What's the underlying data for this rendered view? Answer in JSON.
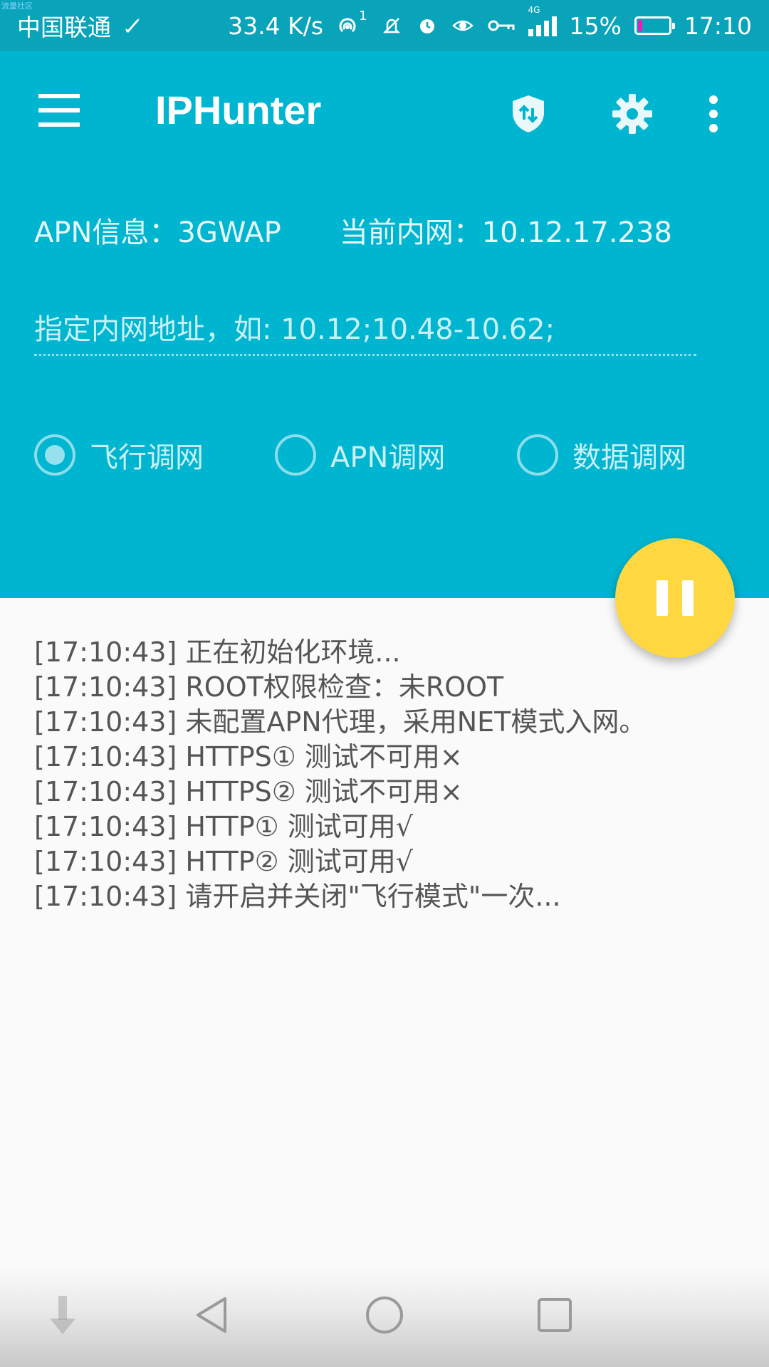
{
  "status_bar": {
    "corner_text": "流量社区",
    "carrier": "中国联通",
    "speed": "33.4 K/s",
    "hotspot_count": "1",
    "network_type": "4G",
    "battery": "15%",
    "battery_level": 0.15,
    "time": "17:10"
  },
  "toolbar": {
    "title": "IPHunter",
    "icons": [
      "menu-icon",
      "shield-icon",
      "gear-icon",
      "more-vert-icon"
    ]
  },
  "info": {
    "apn": "APN信息：3GWAP",
    "intranet": "当前内网：10.12.17.238"
  },
  "ip_input": {
    "value": "",
    "placeholder": "指定内网地址，如: 10.12;10.48-10.62;"
  },
  "mode_options": [
    {
      "label": "飞行调网",
      "selected": true
    },
    {
      "label": "APN调网",
      "selected": false
    },
    {
      "label": "数据调网",
      "selected": false
    }
  ],
  "fab": {
    "icon": "pause-icon"
  },
  "log": [
    "[17:10:43] 正在初始化环境...",
    "[17:10:43] ROOT权限检查：未ROOT",
    "[17:10:43] 未配置APN代理，采用NET模式入网。",
    "[17:10:43] HTTPS① 测试不可用×",
    "[17:10:43] HTTPS② 测试不可用×",
    "[17:10:43] HTTP①   测试可用√",
    "[17:10:43] HTTP②   测试可用√",
    "[17:10:43] 请开启并关闭\"飞行模式\"一次..."
  ],
  "colors": {
    "status_bar": "#0aa4ba",
    "header": "#00b5d0",
    "fab": "#ffd740",
    "log_text": "#555555"
  }
}
